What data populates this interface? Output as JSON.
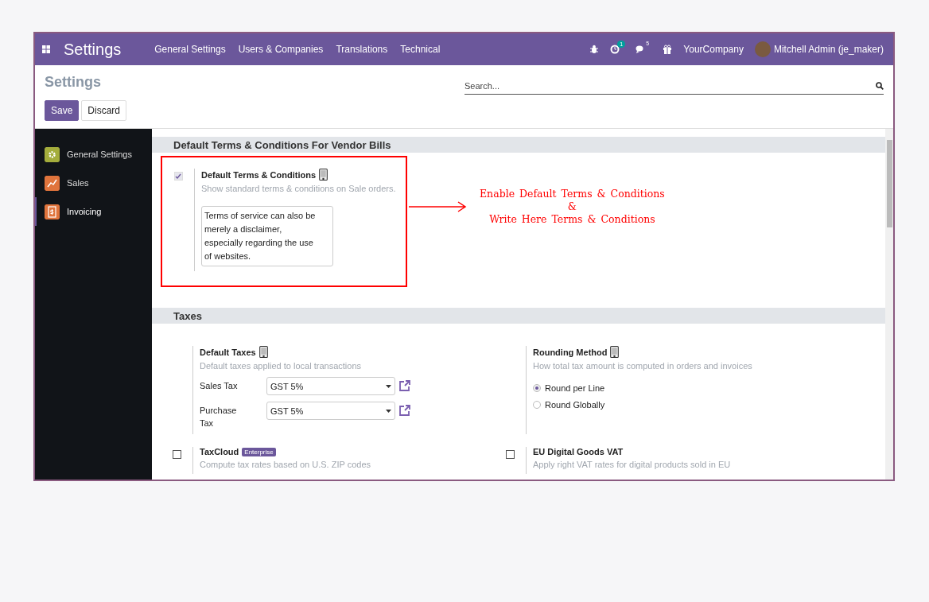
{
  "navbar": {
    "app_title": "Settings",
    "menu": [
      "General Settings",
      "Users & Companies",
      "Translations",
      "Technical"
    ],
    "activity_count": "1",
    "message_count": "5",
    "company": "YourCompany",
    "user": "Mitchell Admin (je_maker)"
  },
  "control_panel": {
    "title": "Settings",
    "search": {
      "placeholder": "Search..."
    },
    "buttons": [
      {
        "label": "Save",
        "kind": "primary"
      },
      {
        "label": "Discard",
        "kind": "secondary"
      }
    ]
  },
  "sidebar": {
    "items": [
      {
        "label": "General Settings",
        "color": "#a4ad3c",
        "kind": "gear",
        "selected": false
      },
      {
        "label": "Sales",
        "color": "#e0743c",
        "kind": "chart",
        "selected": false
      },
      {
        "label": "Invoicing",
        "color": "#e0743c",
        "kind": "invoice",
        "selected": true
      }
    ]
  },
  "sections": [
    {
      "title": "Default Terms & Conditions For Vendor Bills",
      "highlighted": true,
      "settings": [
        {
          "kind": "textarea",
          "title": "Default Terms & Conditions",
          "company_icon": true,
          "description": "Show standard terms & conditions on Sale orders.",
          "checked": true,
          "value": "Terms of service can also be\nmerely a disclaimer,\nespecially regarding the use\nof websites."
        }
      ]
    },
    {
      "title": "Taxes",
      "highlighted": false,
      "settings": [
        {
          "kind": "fields",
          "title": "Default Taxes",
          "company_icon": true,
          "description": "Default taxes applied to local transactions",
          "fields": [
            {
              "label": "Sales Tax",
              "value": "GST 5%"
            },
            {
              "label": "Purchase Tax",
              "value": "GST 5%"
            }
          ]
        },
        {
          "kind": "radio",
          "title": "Rounding Method",
          "company_icon": true,
          "description": "How total tax amount is computed in orders and invoices",
          "options": [
            {
              "label": "Round per Line",
              "selected": true
            },
            {
              "label": "Round Globally",
              "selected": false
            }
          ]
        },
        {
          "kind": "checkbox",
          "title": "TaxCloud",
          "badge": "Enterprise",
          "description": "Compute tax rates based on U.S. ZIP codes",
          "checked": false
        },
        {
          "kind": "checkbox",
          "title": "EU Digital Goods VAT",
          "description": "Apply right VAT rates for digital products sold in EU",
          "checked": false
        }
      ]
    }
  ],
  "annotation": {
    "lines": [
      "Enable Default Terms & Conditions",
      "&",
      "Write Here Terms & Conditions"
    ]
  }
}
